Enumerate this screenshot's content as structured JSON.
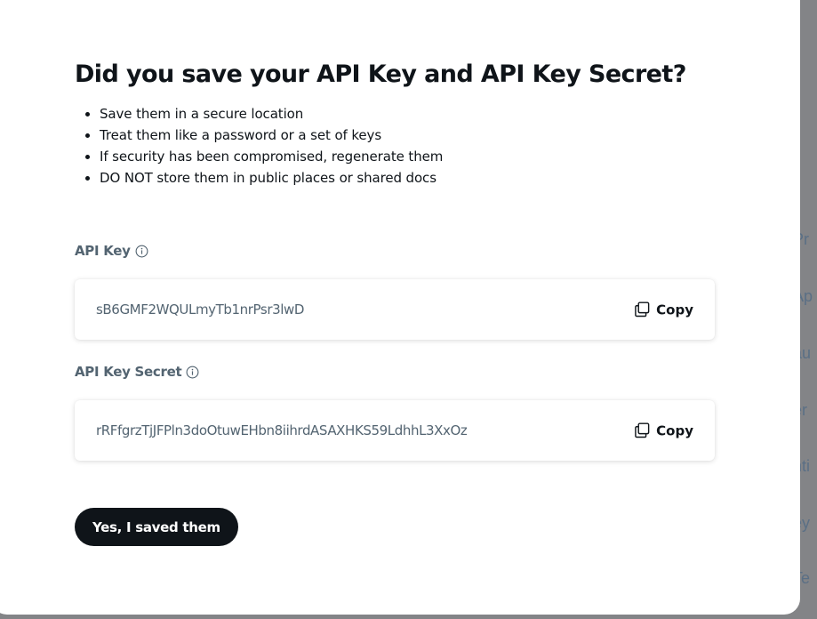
{
  "background": {
    "items": [
      "Pr",
      "Ap",
      "au",
      "er",
      "nti",
      "ey",
      "Te"
    ]
  },
  "modal": {
    "title": "Did you save your API Key and API Key Secret?",
    "bullets": [
      "Save them in a secure location",
      "Treat them like a password or a set of keys",
      "If security has been compromised, regenerate them",
      "DO NOT store them in public places or shared docs"
    ],
    "api_key": {
      "label": "API Key",
      "value": "sB6GMF2WQULmyTb1nrPsr3lwD",
      "copy_label": "Copy"
    },
    "api_key_secret": {
      "label": "API Key Secret",
      "value": "rRFfgrzTjJFPln3doOtuwEHbn8iihrdASAXHKS59LdhhL3XxOz",
      "copy_label": "Copy"
    },
    "confirm_button": "Yes, I saved them"
  },
  "icons": {
    "info": "info-icon",
    "copy": "copy-icon"
  },
  "colors": {
    "text_primary": "#0f1419",
    "text_secondary": "#536471",
    "button_bg": "#0f1419",
    "overlay": "#808184"
  }
}
